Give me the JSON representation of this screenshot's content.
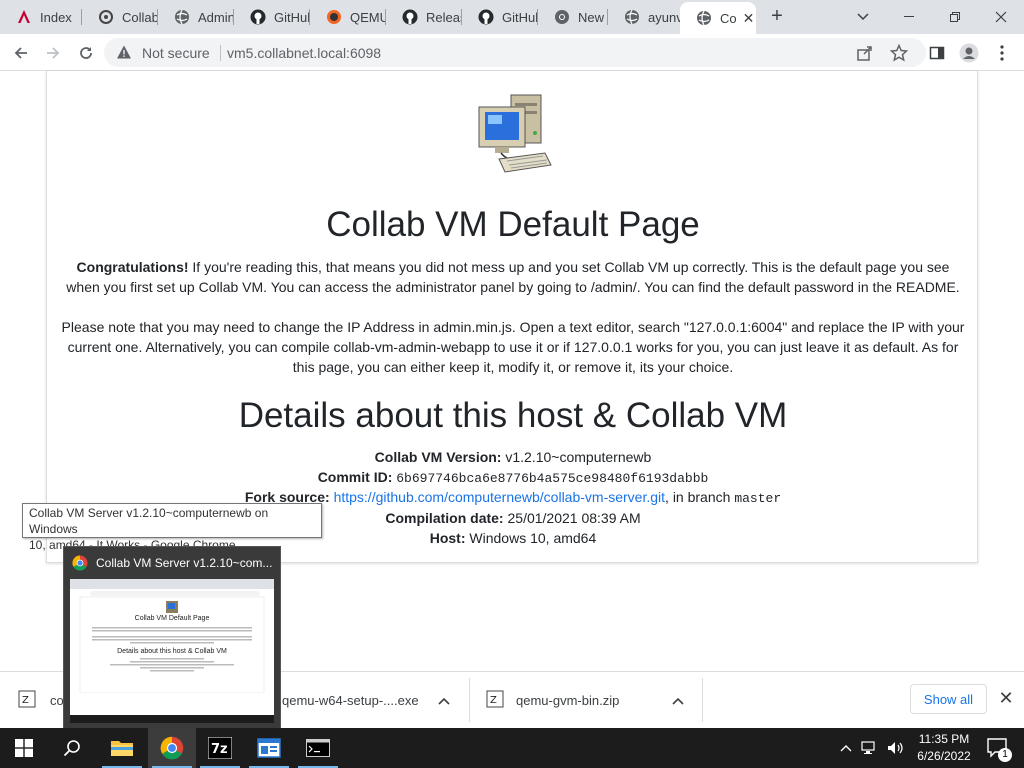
{
  "browser": {
    "tabs": [
      {
        "title": "Index",
        "icon": "angular-icon"
      },
      {
        "title": "Collab",
        "icon": "collabvm-icon"
      },
      {
        "title": "Admin",
        "icon": "globe-icon"
      },
      {
        "title": "GitHub",
        "icon": "github-icon"
      },
      {
        "title": "QEMU",
        "icon": "qemu-icon"
      },
      {
        "title": "Releas",
        "icon": "github-icon"
      },
      {
        "title": "GitHub",
        "icon": "github-icon"
      },
      {
        "title": "New T",
        "icon": "chrome-icon"
      },
      {
        "title": "ayunv",
        "icon": "globe-icon"
      },
      {
        "title": "Co",
        "icon": "globe-icon",
        "active": true
      }
    ],
    "new_tab_label": "+",
    "security_label": "Not secure",
    "url": "vm5.collabnet.local:6098"
  },
  "page": {
    "title": "Collab VM Default Page",
    "para1_bold": "Congratulations!",
    "para1_text": " If you're reading this, that means you did not mess up and you set Collab VM up correctly. This is the default page you see when you first set up Collab VM. You can access the administrator panel by going to /admin/. You can find the default password in the README.",
    "para2_text": "Please note that you may need to change the IP Address in admin.min.js. Open a text editor, search \"127.0.0.1:6004\" and replace the IP with your current one. Alternatively, you can compile collab-vm-admin-webapp to use it or if 127.0.0.1 works for you, you can just leave it as default. As for this page, you can either keep it, modify it, or remove it, its your choice.",
    "details_heading": "Details about this host & Collab VM",
    "details": {
      "version_label": "Collab VM Version:",
      "version_value": " v1.2.10~computernewb",
      "commit_label": "Commit ID:",
      "commit_value": "6b697746bca6e8776b4a575ce98480f6193dabbb",
      "fork_label": "Fork source:",
      "fork_link": "https://github.com/computernewb/collab-vm-server.git",
      "fork_branch_prefix": ", in branch ",
      "fork_branch": "master",
      "compilation_label": "Compilation date:",
      "compilation_value": " 25/01/2021 08:39 AM",
      "host_label": "Host:",
      "host_value": " Windows 10, amd64"
    }
  },
  "tooltip": {
    "line1": "Collab VM Server v1.2.10~computernewb on Windows",
    "line2": "10, amd64 - It Works - Google Chrome"
  },
  "thumbnail": {
    "title": "Collab VM Server v1.2.10~com...",
    "mini_title": "Collab VM Default Page",
    "mini_heading": "Details about this host & Collab VM"
  },
  "downloads": {
    "items": [
      {
        "name": "co"
      },
      {
        "name": "qemu-w64-setup-....exe"
      },
      {
        "name": "qemu-gvm-bin.zip"
      }
    ],
    "show_all": "Show all"
  },
  "taskbar": {
    "apps": [
      "start",
      "search",
      "file-explorer",
      "chrome",
      "7zip",
      "app",
      "terminal"
    ],
    "time": "11:35 PM",
    "date": "6/26/2022",
    "notification_count": "1"
  },
  "colors": {
    "link": "#1a73e8",
    "tabstrip": "#dee1e6",
    "taskbar": "#1c1c1c"
  }
}
